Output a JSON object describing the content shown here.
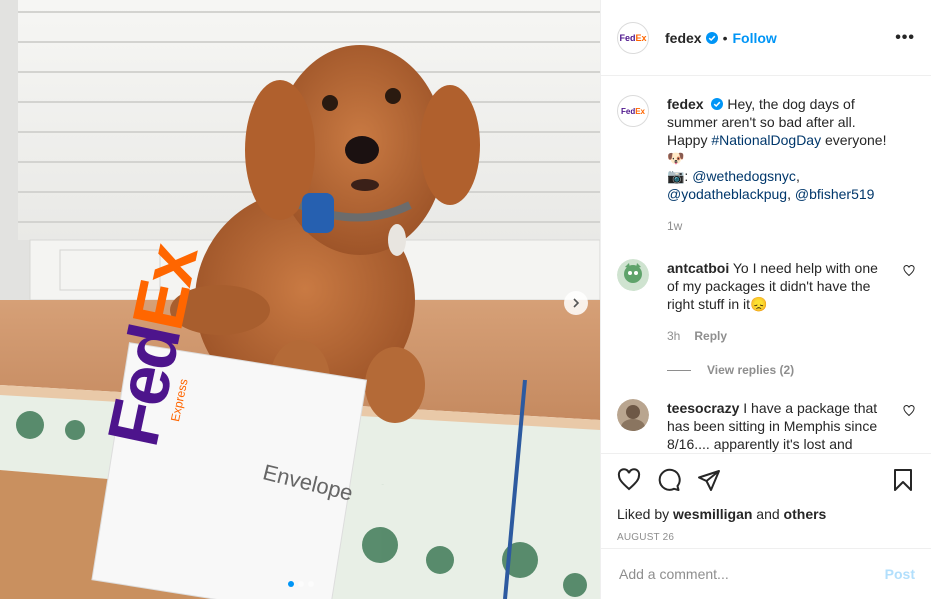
{
  "post": {
    "account": "fedex",
    "follow_label": "Follow",
    "more_label": "•••",
    "envelope_text": "Envelope",
    "envelope_brand_fe": "Fed",
    "envelope_brand_ex": "Ex",
    "envelope_brand_sub": "Express",
    "logo_fe": "Fed",
    "logo_ex": "Ex"
  },
  "caption": {
    "user": "fedex",
    "text_1": "Hey, the dog days of summer aren't so bad after all. Happy",
    "hashtag": "#NationalDogDay",
    "text_2": "everyone! 🐶",
    "camera": "📷: ",
    "mention_1": "@wethedogsnyc",
    "mention_2": "@yodatheblackpug",
    "mention_3": "@bfisher519",
    "time": "1w"
  },
  "comments": [
    {
      "user": "antcatboi",
      "text": "Yo I need help with one of my packages it didn't have the right stuff in it😞",
      "time": "3h",
      "reply_label": "Reply"
    },
    {
      "user": "teesocrazy",
      "text": "I have a package that has been sitting in Memphis since 8/16.... apparently it's lost and customer service provided no"
    }
  ],
  "view_replies": "View replies (2)",
  "likes": {
    "prefix": "Liked by",
    "user": "wesmilligan",
    "and": "and",
    "others": "others"
  },
  "date": "AUGUST 26",
  "add_comment": {
    "placeholder": "Add a comment...",
    "post_label": "Post"
  },
  "colors": {
    "accent": "#0095f6",
    "fedex_purple": "#4d148c",
    "fedex_orange": "#ff6600"
  }
}
